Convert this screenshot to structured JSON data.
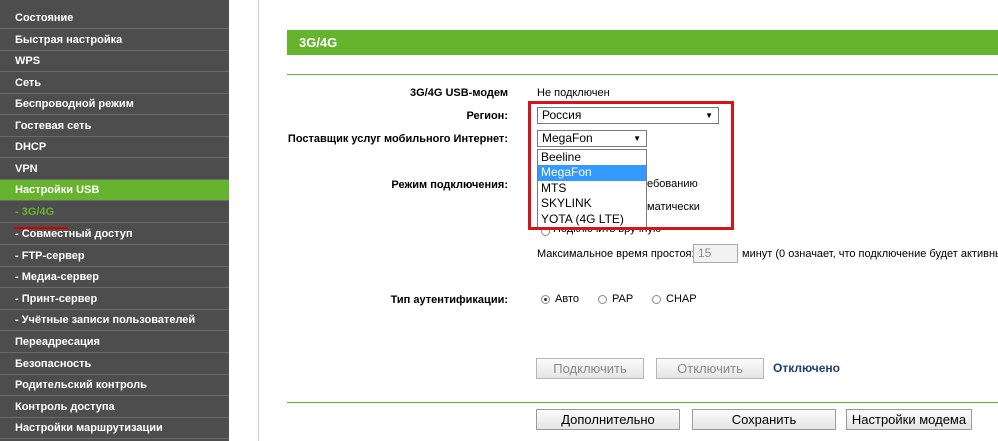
{
  "sidebar": {
    "items": [
      {
        "label": "Состояние"
      },
      {
        "label": "Быстрая настройка"
      },
      {
        "label": "WPS"
      },
      {
        "label": "Сеть"
      },
      {
        "label": "Беспроводной режим"
      },
      {
        "label": "Гостевая сеть"
      },
      {
        "label": "DHCP"
      },
      {
        "label": "VPN"
      },
      {
        "label": "Настройки USB"
      },
      {
        "label": "- 3G/4G"
      },
      {
        "label": "- Совместный доступ"
      },
      {
        "label": "- FTP-сервер"
      },
      {
        "label": "- Медиа-сервер"
      },
      {
        "label": "- Принт-сервер"
      },
      {
        "label": "- Учётные записи пользователей"
      },
      {
        "label": "Переадресация"
      },
      {
        "label": "Безопасность"
      },
      {
        "label": "Родительский контроль"
      },
      {
        "label": "Контроль доступа"
      },
      {
        "label": "Настройки маршрутизации"
      }
    ]
  },
  "header": {
    "title": "3G/4G"
  },
  "form": {
    "modem_label": "3G/4G USB-модем",
    "modem_value": "Не подключен",
    "region_label": "Регион:",
    "region_value": "Россия",
    "provider_label": "Поставщик услуг мобильного Интернет:",
    "provider_value": "MegaFon",
    "provider_options": [
      "Beeline",
      "MegaFon",
      "MTS",
      "SKYLINK",
      "YOTA (4G LTE)"
    ],
    "mode_label": "Режим подключения:",
    "mode_options": [
      "ебованию",
      "матически",
      "Подключить вручную"
    ],
    "idle_label": "Максимальное время простоя:",
    "idle_value": "15",
    "idle_suffix": "минут (0 означает, что подключение будет активны",
    "auth_label": "Тип аутентификации:",
    "auth_options": [
      "Авто",
      "PAP",
      "CHAP"
    ]
  },
  "actions": {
    "connect": "Подключить",
    "disconnect": "Отключить",
    "status": "Отключено",
    "advanced": "Дополнительно",
    "save": "Сохранить",
    "modem_settings": "Настройки модема"
  },
  "colors": {
    "accent": "#66b42d",
    "sidebar_bg": "#4d4d4d",
    "highlight": "#d4151c",
    "status": "#1f3f7a"
  }
}
